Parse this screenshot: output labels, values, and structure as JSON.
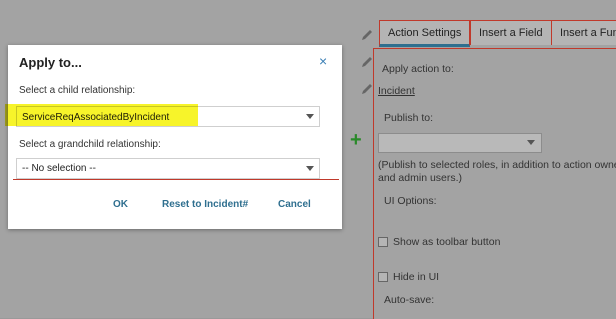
{
  "dialog": {
    "title": "Apply to...",
    "close_glyph": "×",
    "child_label": "Select a child relationship:",
    "child_value": "ServiceReqAssociatedByIncident",
    "grandchild_label": "Select a grandchild relationship:",
    "grandchild_value": "-- No selection --",
    "ok_label": "OK",
    "reset_label": "Reset to Incident#",
    "cancel_label": "Cancel"
  },
  "tabs": [
    {
      "label": "Action Settings",
      "active": true
    },
    {
      "label": "Insert a Field",
      "active": false
    },
    {
      "label": "Insert a Func",
      "active": false
    }
  ],
  "panel": {
    "apply_action_label": "Apply action to:",
    "apply_action_link": "Incident",
    "publish_label": "Publish to:",
    "publish_note_1": "(Publish to selected roles, in addition to action owne",
    "publish_note_2": "and admin users.)",
    "ui_options_label": "UI Options:",
    "toolbar_label": "Show as toolbar button",
    "hide_label": "Hide in UI",
    "autosave_label": "Auto-save:"
  },
  "colors": {
    "highlight": "#f7f42a",
    "annotation_red": "#c0392b",
    "button_blue": "#2f6f8f",
    "plus_green": "#2a8a2a"
  },
  "icons": {
    "edit": "pencil-icon",
    "add": "plus-icon",
    "close": "close-icon",
    "dropdown": "chevron-down-icon"
  }
}
